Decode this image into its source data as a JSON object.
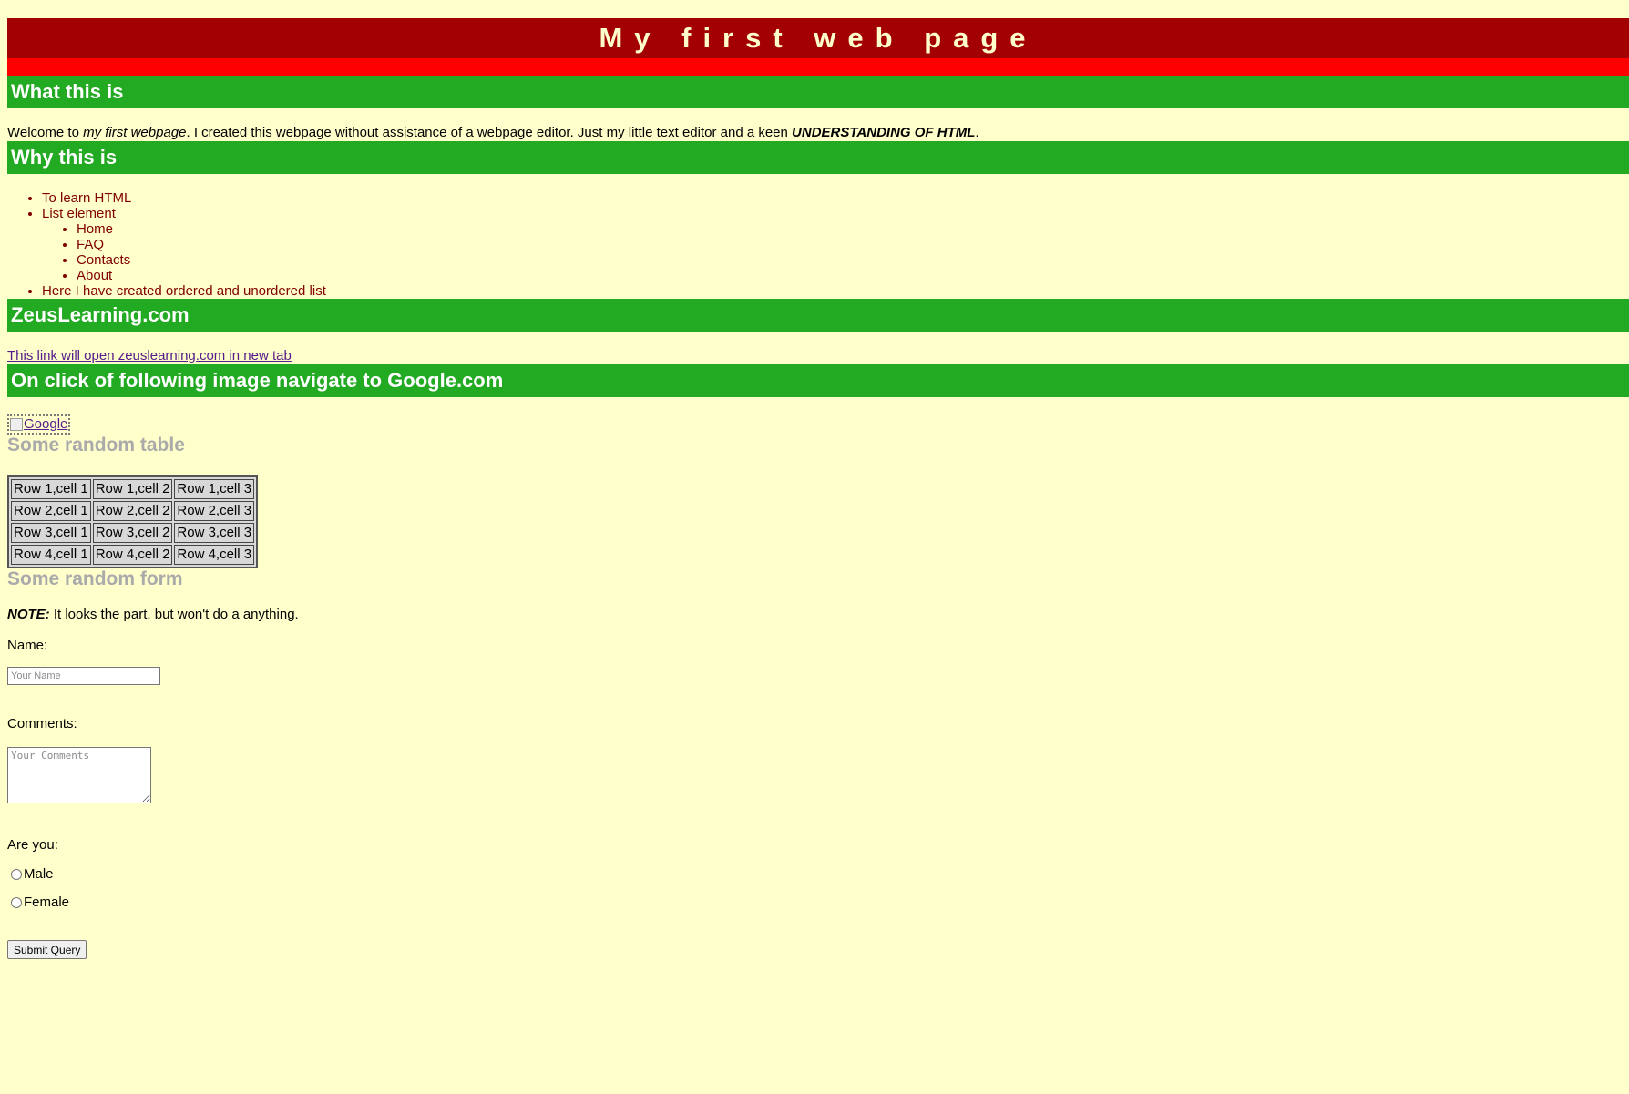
{
  "header": {
    "title": "My first web page"
  },
  "section_what": {
    "heading": "What this is",
    "intro_prefix": "Welcome to ",
    "intro_em": "my first webpage",
    "intro_middle": ". I created this webpage without assistance of a webpage editor. Just my little text editor and a keen ",
    "intro_strong": "UNDERSTANDING OF HTML",
    "intro_suffix": "."
  },
  "section_why": {
    "heading": "Why this is",
    "items": [
      "To learn HTML",
      "List element",
      "Here I have created ordered and unordered list"
    ],
    "sub_items": [
      "Home",
      "FAQ",
      "Contacts",
      "About"
    ]
  },
  "section_zeus": {
    "heading": "ZeusLearning.com",
    "link_text": "This link will open zeuslearning.com in new tab"
  },
  "section_google": {
    "heading": "On click of following image navigate to Google.com",
    "image_alt": "Google"
  },
  "table": {
    "heading": "Some random table",
    "rows": [
      [
        "Row 1,cell 1",
        "Row 1,cell 2",
        "Row 1,cell 3"
      ],
      [
        "Row 2,cell 1",
        "Row 2,cell 2",
        "Row 2,cell 3"
      ],
      [
        "Row 3,cell 1",
        "Row 3,cell 2",
        "Row 3,cell 3"
      ],
      [
        "Row 4,cell 1",
        "Row 4,cell 2",
        "Row 4,cell 3"
      ]
    ]
  },
  "form": {
    "heading": "Some random form",
    "note_label": "NOTE:",
    "note_text": " It looks the part, but won't do a anything.",
    "name_label": "Name:",
    "name_placeholder": "Your Name",
    "comments_label": "Comments:",
    "comments_placeholder": "Your Comments",
    "gender_label": "Are you:",
    "gender_options": [
      "Male",
      "Female"
    ],
    "submit_label": "Submit Query"
  },
  "colors": {
    "background": "#ffffcc",
    "title_bg": "#a30004",
    "title_bar": "#ff0000",
    "section_bg": "#22aa22",
    "list_text": "#800000",
    "subheading": "#aaaaaa",
    "link": "#551a8b"
  }
}
